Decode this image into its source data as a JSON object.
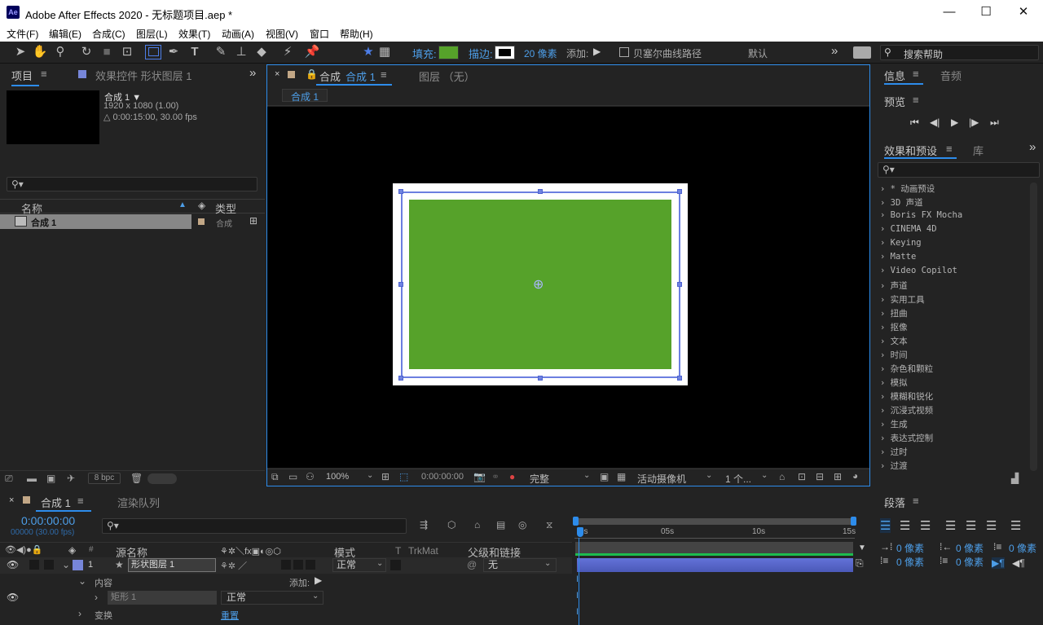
{
  "window": {
    "title": "Adobe After Effects 2020 - 无标题项目.aep *",
    "app_badge": "Ae",
    "minimize": "—",
    "maximize": "☐",
    "close": "✕"
  },
  "menu": [
    "文件(F)",
    "编辑(E)",
    "合成(C)",
    "图层(L)",
    "效果(T)",
    "动画(A)",
    "视图(V)",
    "窗口",
    "帮助(H)"
  ],
  "toolbar": {
    "fill_label": "填充:",
    "stroke_label": "描边:",
    "stroke_px": "20 像素",
    "add_label": "添加:",
    "bezier_label": "贝塞尔曲线路径",
    "workspace": "默认",
    "more": "»",
    "search_placeholder": "搜索帮助",
    "fill_color": "#56a22a"
  },
  "project_panel": {
    "tab_project": "项目",
    "tab_effects": "效果控件 形状图层 1",
    "comp_name": "合成 1 ▼",
    "comp_res": "1920 x 1080 (1.00)",
    "comp_dur": "△ 0:00:15:00, 30.00 fps",
    "col_name": "名称",
    "col_type": "类型",
    "item_name": "合成 1",
    "item_type": "合成",
    "bpc": "8 bpc"
  },
  "comp_panel": {
    "tab_label": "合成",
    "tab_comp": "合成 1",
    "layer_tab": "图层 （无）",
    "breadcrumb": "合成 1",
    "zoom": "100%",
    "timecode": "0:00:00:00",
    "quality": "完整",
    "camera": "活动摄像机",
    "views": "1 个...",
    "shape_color": "#56a22a"
  },
  "info_panel": {
    "tab_info": "信息",
    "tab_audio": "音频",
    "preview": "预览"
  },
  "effects_panel": {
    "tab_effects": "效果和预设",
    "tab_lib": "库",
    "items": [
      "* 动画预设",
      "3D 声道",
      "Boris FX Mocha",
      "CINEMA 4D",
      "Keying",
      "Matte",
      "Video Copilot",
      "声道",
      "实用工具",
      "扭曲",
      "抠像",
      "文本",
      "时间",
      "杂色和颗粒",
      "模拟",
      "模糊和锐化",
      "沉浸式视频",
      "生成",
      "表达式控制",
      "过时",
      "过渡"
    ]
  },
  "paragraph_panel": {
    "tab": "段落",
    "px0": "0 像素",
    "px1": "0 像素",
    "px2": "0 像素",
    "px3": "0 像素",
    "px4": "0 像素"
  },
  "timeline": {
    "tab_comp": "合成 1",
    "tab_render": "渲染队列",
    "timecode": "0:00:00:00",
    "frames": "00000 (30.00 fps)",
    "col_source": "源名称",
    "col_mode": "模式",
    "col_t": "T",
    "col_trkmat": "TrkMat",
    "col_parent": "父级和链接",
    "layer_num": "1",
    "layer_name": "形状图层 1",
    "layer_mode": "正常",
    "layer_parent": "无",
    "contents": "内容",
    "add_label": "添加:",
    "rect": "矩形 1",
    "rect_mode": "正常",
    "transform": "变换",
    "reset": "重置",
    "ruler": [
      "0s",
      "05s",
      "10s",
      "15s"
    ]
  }
}
